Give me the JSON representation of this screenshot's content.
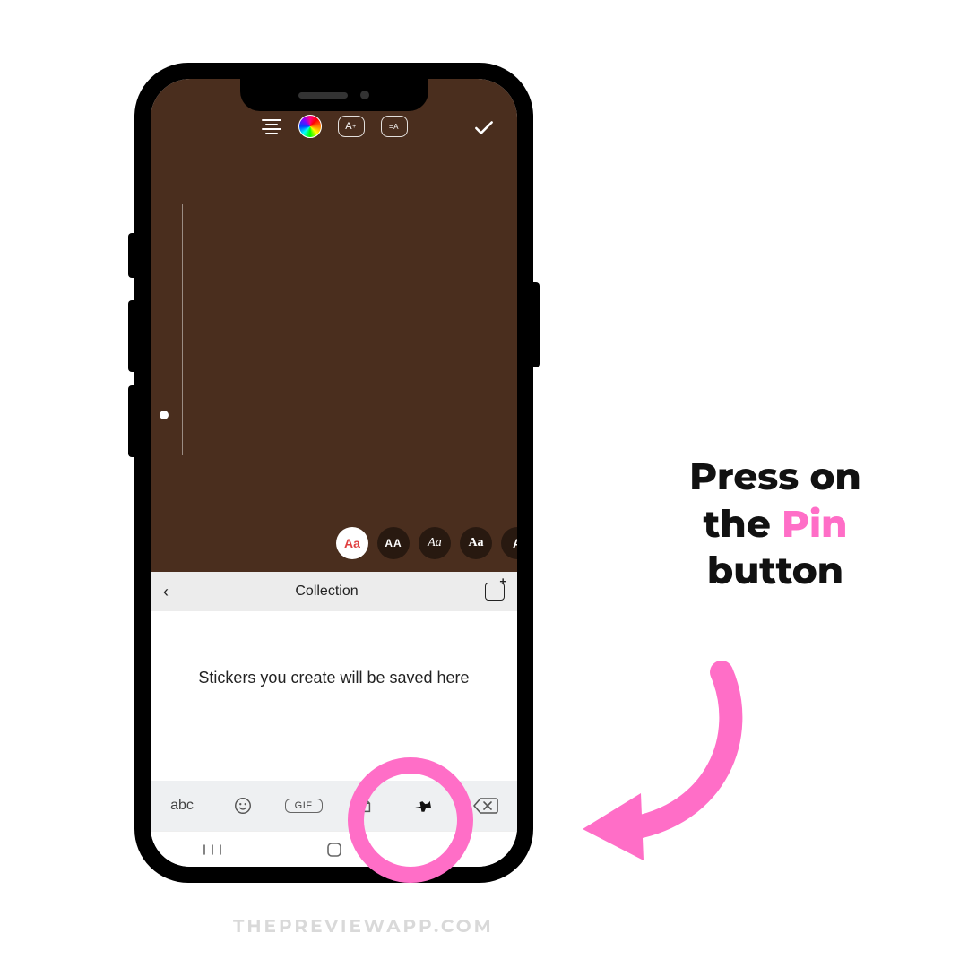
{
  "editor": {
    "toolbar": {
      "align_icon": "align",
      "color_icon": "color-wheel",
      "size_box_label": "A+",
      "animate_box_label": "=A"
    },
    "fonts": [
      "Aa",
      "AA",
      "Aa",
      "Aa",
      "A"
    ]
  },
  "collection": {
    "back_glyph": "‹",
    "title": "Collection"
  },
  "sticker_area": {
    "empty_text": "Stickers you create will be saved here"
  },
  "keyboard": {
    "abc_label": "abc",
    "gif_label": "GIF"
  },
  "caption": {
    "line1": "Press on",
    "line2_pre": "the ",
    "line2_pink": "Pin",
    "line3": "button"
  },
  "watermark": "THEPREVIEWAPP.COM",
  "colors": {
    "pink": "#ff6ec7",
    "editor_bg": "#4a2e1e"
  }
}
